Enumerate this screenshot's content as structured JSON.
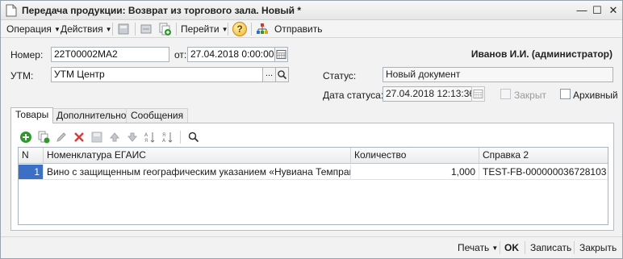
{
  "window": {
    "title": "Передача продукции: Возврат из торгового зала. Новый *",
    "minimize_glyph": "—",
    "maximize_glyph": "☐",
    "close_glyph": "✕"
  },
  "toolbar": {
    "operation_label": "Операция",
    "actions_label": "Действия",
    "goto_label": "Перейти",
    "send_label": "Отправить",
    "help_glyph": "?"
  },
  "form": {
    "number_label": "Номер:",
    "number_value": "22T00002MA2",
    "from_label": "от:",
    "date_value": "27.04.2018  0:00:00",
    "utm_label": "УТМ:",
    "utm_value": "УТМ Центр",
    "utm_select_glyph": "...",
    "user_name": "Иванов И.И. (администратор)",
    "status_label": "Статус:",
    "status_value": "Новый документ",
    "status_date_label": "Дата статуса:",
    "status_date_value": "27.04.2018 12:13:36",
    "closed_label": "Закрыт",
    "archived_label": "Архивный"
  },
  "tabs": [
    {
      "label": "Товары",
      "active": true
    },
    {
      "label": "Дополнительно",
      "active": false
    },
    {
      "label": "Сообщения",
      "active": false
    }
  ],
  "table": {
    "columns": [
      "N",
      "Номенклатура ЕГАИС",
      "Количество",
      "Справка 2"
    ],
    "rows": [
      {
        "n": "1",
        "nomenclature": "Вино с защищенным географическим указанием «Нувиана Темпрани…",
        "quantity": "1,000",
        "reference": "TEST-FB-000000036728103"
      }
    ]
  },
  "footer": {
    "print_label": "Печать",
    "ok_label": "OK",
    "save_label": "Записать",
    "close_label": "Закрыть"
  },
  "colors": {
    "selected_row": "#3d6fc4",
    "add_green": "#2e9a2e",
    "delete_red": "#d93a3a"
  }
}
